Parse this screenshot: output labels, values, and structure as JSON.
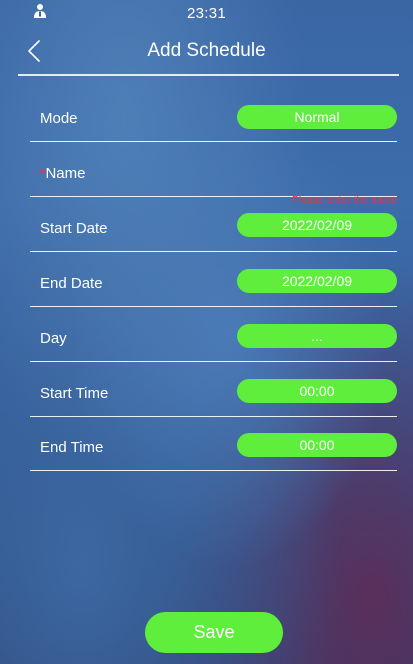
{
  "status_bar": {
    "time": "23:31",
    "icon": "person-icon"
  },
  "header": {
    "back_icon": "chevron-left-icon",
    "title": "Add Schedule"
  },
  "form": {
    "mode": {
      "label": "Mode",
      "value": "Normal"
    },
    "name": {
      "required_mark": "*",
      "label": "Name",
      "value": "",
      "error": "Please enter the name"
    },
    "start_date": {
      "label": "Start Date",
      "value": "2022/02/09"
    },
    "end_date": {
      "label": "End Date",
      "value": "2022/02/09"
    },
    "day": {
      "label": "Day",
      "value": "..."
    },
    "start_time": {
      "label": "Start Time",
      "value": "00:00"
    },
    "end_time": {
      "label": "End Time",
      "value": "00:00"
    }
  },
  "actions": {
    "save_label": "Save"
  },
  "colors": {
    "accent_green": "#5fee3c",
    "error_red": "#e53935",
    "background_blue": "#3a66a4"
  }
}
